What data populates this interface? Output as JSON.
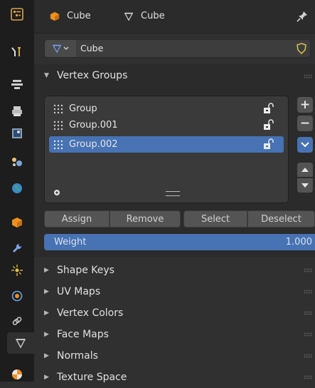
{
  "header": {
    "object_name": "Cube",
    "mesh_name": "Cube",
    "object_icon": "object-cube-icon",
    "mesh_icon": "mesh-data-icon",
    "pin_icon": "pin-icon"
  },
  "data_selector": {
    "value": "Cube",
    "type_icon": "mesh-data-icon",
    "fake_user_icon": "shield-icon"
  },
  "vertex_groups": {
    "title": "Vertex Groups",
    "items": [
      {
        "label": "Group",
        "selected": false
      },
      {
        "label": "Group.001",
        "selected": false
      },
      {
        "label": "Group.002",
        "selected": true
      }
    ],
    "side_buttons": {
      "add": "+",
      "remove": "−"
    },
    "buttons": {
      "assign": "Assign",
      "remove": "Remove",
      "select": "Select",
      "deselect": "Deselect"
    },
    "weight": {
      "label": "Weight",
      "value": "1.000"
    }
  },
  "sections": [
    {
      "label": "Shape Keys"
    },
    {
      "label": "UV Maps"
    },
    {
      "label": "Vertex Colors"
    },
    {
      "label": "Face Maps"
    },
    {
      "label": "Normals"
    },
    {
      "label": "Texture Space"
    }
  ],
  "tabs": [
    "tool",
    "render",
    "output",
    "view-layer",
    "scene",
    "world",
    "object",
    "modifiers",
    "particles",
    "physics",
    "constraints",
    "data",
    "material"
  ],
  "colors": {
    "accent": "#4772b3",
    "panel": "#303030",
    "sidebar": "#1d1d1d",
    "orange": "#f0901e",
    "lock": "#eaeaea"
  }
}
